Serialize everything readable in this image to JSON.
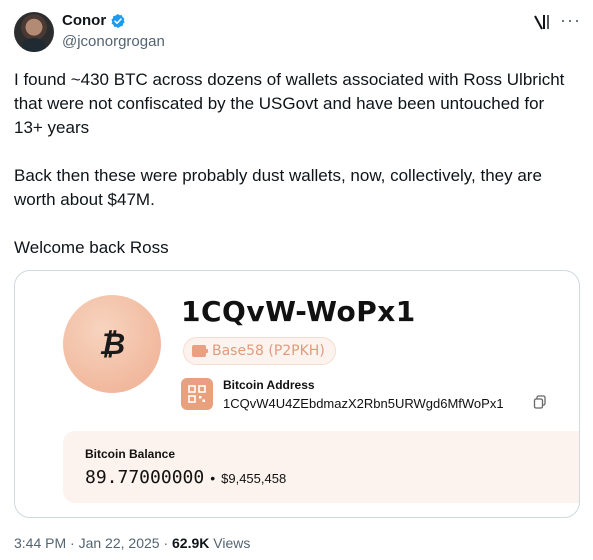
{
  "author": {
    "name": "Conor",
    "handle": "@jconorgrogan",
    "verified_color": "#1d9bf0"
  },
  "tweet": {
    "text": "I found ~430 BTC across dozens of wallets associated with Ross Ulbricht that were not confiscated by the USGovt and have been untouched for 13+ years\n\nBack then these were probably dust wallets, now, collectively, they are worth about $47M.\n\nWelcome back Ross"
  },
  "card": {
    "wallet_short": "1CQvW-WoPx1",
    "format_badge": "Base58 (P2PKH)",
    "address_label": "Bitcoin Address",
    "address": "1CQvW4U4ZEbdmazX2Rbn5URWgd6MfWoPx1",
    "balance_label": "Bitcoin Balance",
    "balance_btc": "89.77000000",
    "separator": "•",
    "balance_usd": "$9,455,458",
    "accent_color": "#e9a07e"
  },
  "meta": {
    "time": "3:44 PM",
    "dot": "·",
    "date": "Jan 22, 2025",
    "views_count": "62.9K",
    "views_label": "Views"
  },
  "icons": {
    "more": "more-icon",
    "grok": "grok-icon",
    "copy": "copy-icon",
    "wallet": "wallet-icon",
    "qr": "qr-icon"
  }
}
